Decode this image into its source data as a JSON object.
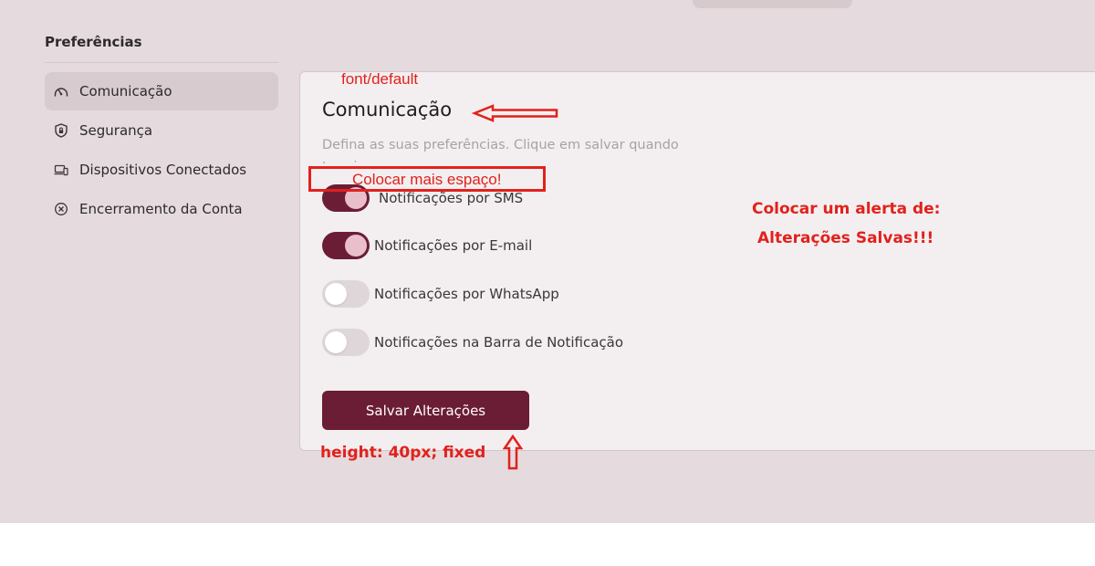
{
  "sidebar": {
    "title": "Preferências",
    "items": [
      {
        "label": "Comunicação",
        "icon": "gauge-icon",
        "active": true
      },
      {
        "label": "Segurança",
        "icon": "shield-lock-icon",
        "active": false
      },
      {
        "label": "Dispositivos Conectados",
        "icon": "devices-icon",
        "active": false
      },
      {
        "label": "Encerramento da Conta",
        "icon": "close-circle-icon",
        "active": false
      }
    ]
  },
  "main": {
    "title": "Comunicação",
    "description": "Defina as suas preferências. Clique em salvar quando terminar.",
    "toggles": [
      {
        "label": "Notificações por SMS",
        "on": true
      },
      {
        "label": "Notificações por E-mail",
        "on": true
      },
      {
        "label": "Notificações por WhatsApp",
        "on": false
      },
      {
        "label": "Notificações na Barra de Notificação",
        "on": false
      }
    ],
    "save_label": "Salvar Alterações"
  },
  "annotations": {
    "font_note": "font/default",
    "space_note": "Colocar mais espaço!",
    "alert_line1": "Colocar um alerta de:",
    "alert_line2": "Alterações Salvas!!!",
    "height_note": "height: 40px; fixed"
  },
  "colors": {
    "brand": "#6b1d35",
    "knob_on": "#e9bfcc",
    "background": "#e5dbde",
    "annotation": "#e2211c"
  }
}
